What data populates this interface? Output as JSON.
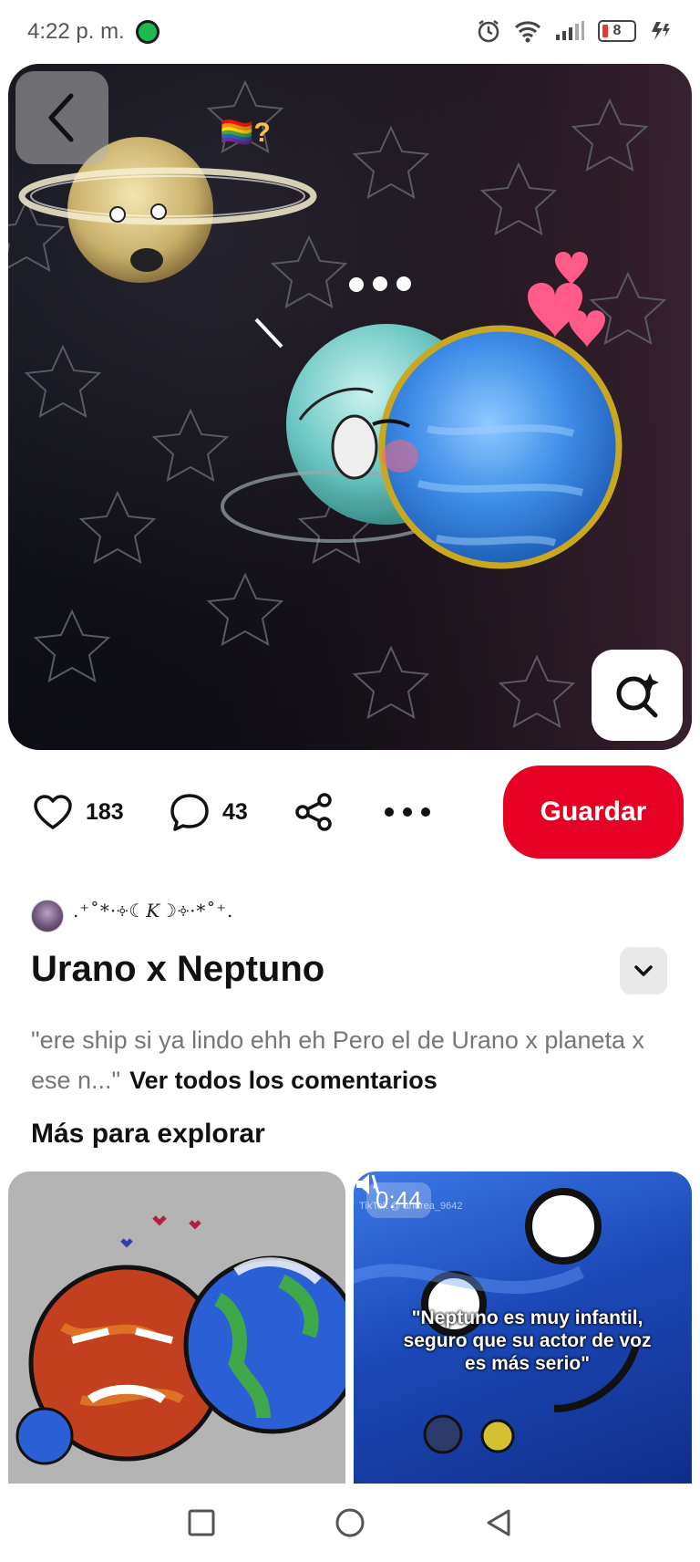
{
  "status_bar": {
    "time": "4:22 p. m.",
    "battery_level": "8"
  },
  "pin": {
    "likes": "183",
    "comments": "43",
    "save_label": "Guardar",
    "creator_name": ".⁺˚*·༓☾𝐾☽༓·*˚⁺.",
    "title": "Urano x Neptuno",
    "comment_text": "\"ere ship si ya lindo ehh eh Pero el de Urano x planeta x ese n...\"",
    "see_all_comments": "Ver todos los comentarios",
    "image_emoji": "🏳️‍🌈?"
  },
  "explore": {
    "title": "Más para explorar",
    "cards": [
      {
        "type": "image"
      },
      {
        "type": "video",
        "duration": "0:44",
        "watermark": "TikTok @ andrea_9642",
        "caption": "\"Neptuno es muy infantil, seguro que su actor de voz es más serio\""
      }
    ]
  },
  "icons": {
    "back": "chevron-left-icon",
    "visual_search": "visual-search-icon",
    "like": "heart-icon",
    "comment": "comment-icon",
    "share": "share-icon",
    "more": "more-icon",
    "expand": "chevron-down-icon"
  },
  "colors": {
    "save_button": "#e60023",
    "text_primary": "#111111",
    "text_muted": "#767676"
  }
}
